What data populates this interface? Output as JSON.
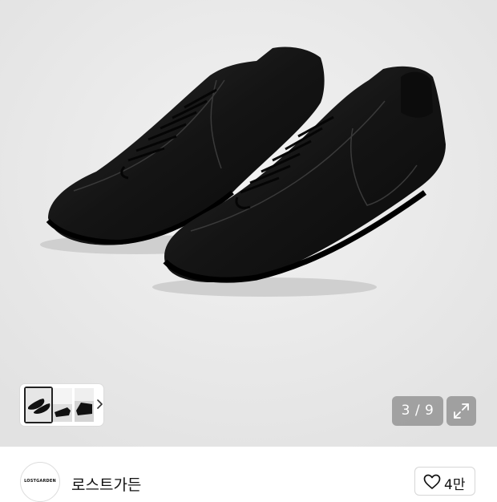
{
  "gallery": {
    "counter": "3 / 9",
    "thumbnails": [
      "thumbnail-1",
      "thumbnail-2",
      "thumbnail-3"
    ],
    "next_icon": "chevron-right-icon",
    "expand_icon": "expand-icon"
  },
  "store": {
    "logo_text": "LOSTGARDEN",
    "name": "로스트가든",
    "like_icon": "heart-icon",
    "like_count": "4만"
  },
  "colors": {
    "hero_background": "#e8e8e8",
    "overlay": "#787878",
    "text": "#111111"
  }
}
